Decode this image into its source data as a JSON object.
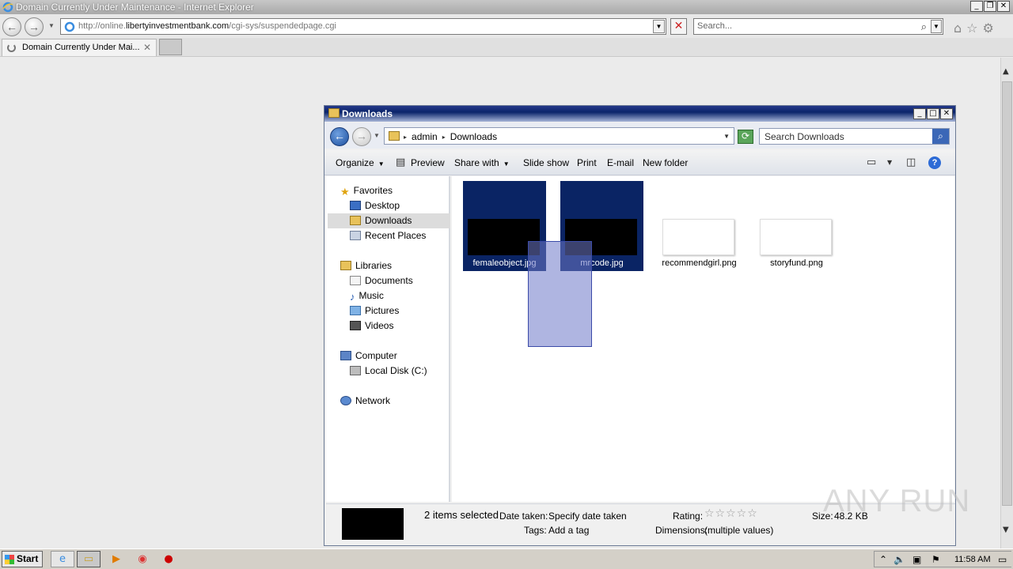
{
  "ie": {
    "window_title": "Domain Currently Under Maintenance - Internet Explorer",
    "url_prefix": "http://online.",
    "url_domain": "libertyinvestmentbank.com",
    "url_path": "/cgi-sys/suspendedpage.cgi",
    "search_placeholder": "Search...",
    "tab_label": "Domain Currently Under Mai..."
  },
  "explorer": {
    "title": "Downloads",
    "breadcrumb": [
      "admin",
      "Downloads"
    ],
    "search_placeholder": "Search Downloads",
    "toolbar": {
      "organize": "Organize",
      "preview": "Preview",
      "share_with": "Share with",
      "slide_show": "Slide show",
      "print": "Print",
      "email": "E-mail",
      "new_folder": "New folder"
    },
    "nav": {
      "favorites": "Favorites",
      "desktop": "Desktop",
      "downloads": "Downloads",
      "recent_places": "Recent Places",
      "libraries": "Libraries",
      "documents": "Documents",
      "music": "Music",
      "pictures": "Pictures",
      "videos": "Videos",
      "computer": "Computer",
      "local_disk": "Local Disk (C:)",
      "network": "Network"
    },
    "files": [
      {
        "name": "femaleobject.jpg",
        "selected": true
      },
      {
        "name": "mrcode.jpg",
        "selected": true
      },
      {
        "name": "recommendgirl.png",
        "selected": false
      },
      {
        "name": "storyfund.png",
        "selected": false
      }
    ],
    "details": {
      "selection": "2 items selected",
      "date_taken_label": "Date taken:",
      "date_taken_value": "Specify date taken",
      "tags_label": "Tags:",
      "tags_value": "Add a tag",
      "rating_label": "Rating:",
      "dimensions_label": "Dimensions:",
      "dimensions_value": "(multiple values)",
      "size_label": "Size:",
      "size_value": "48.2 KB"
    }
  },
  "taskbar": {
    "start": "Start",
    "clock": "11:58 AM"
  },
  "watermark": "ANY RUN"
}
